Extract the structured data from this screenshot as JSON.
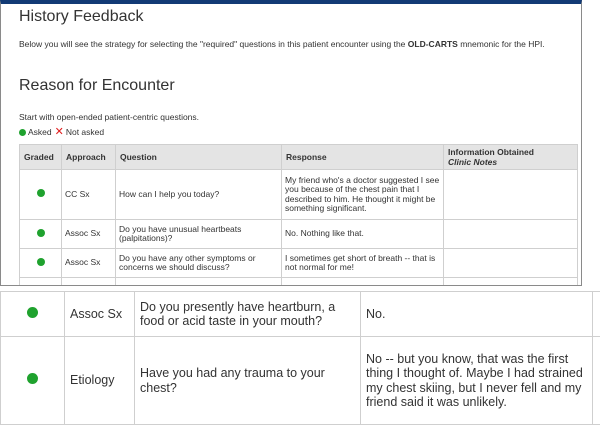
{
  "header": {
    "title": "History Feedback",
    "intro_text": "Below you will see the strategy for selecting the \"required\" questions in this patient encounter using the",
    "intro_bold": "OLD-CARTS",
    "intro_suffix": "mnemonic for the HPI."
  },
  "section": {
    "title": "Reason for Encounter",
    "prompt": "Start with open-ended patient-centric questions."
  },
  "legend": {
    "asked": "Asked",
    "not_asked": "Not asked",
    "asked_color": "#1fa22e",
    "not_asked_color": "#e01b1b",
    "asked_icon": "green-dot-icon",
    "not_asked_icon": "red-x-icon"
  },
  "table": {
    "columns": {
      "graded": "Graded",
      "approach": "Approach",
      "question": "Question",
      "response": "Response",
      "info_line1": "Information Obtained",
      "info_line2": "Clinic Notes"
    },
    "rows": [
      {
        "graded": "asked",
        "approach": "CC Sx",
        "question": "How can I help you today?",
        "response": "My friend who's a doctor suggested I see you because of the chest pain that I described to him. He thought it might be something significant.",
        "info": ""
      },
      {
        "graded": "asked",
        "approach": "Assoc Sx",
        "question": "Do you have unusual heartbeats (palpitations)?",
        "response": "No. Nothing like that.",
        "info": ""
      },
      {
        "graded": "asked",
        "approach": "Assoc Sx",
        "question": "Do you have any other symptoms or concerns we should discuss?",
        "response": "I sometimes get short of breath -- that is not normal for me!",
        "info": ""
      }
    ]
  },
  "zoomed_rows": [
    {
      "graded": "asked",
      "approach": "Assoc Sx",
      "question": "Do you presently have heartburn, a food or acid taste in your mouth?",
      "response": "No.",
      "info": ""
    },
    {
      "graded": "asked",
      "approach": "Etiology",
      "question": "Have you had any trauma to your chest?",
      "response": "No -- but you know, that was the first thing I thought of. Maybe I had strained my chest skiing, but I never fell and my friend said it was unlikely.",
      "info": ""
    }
  ]
}
